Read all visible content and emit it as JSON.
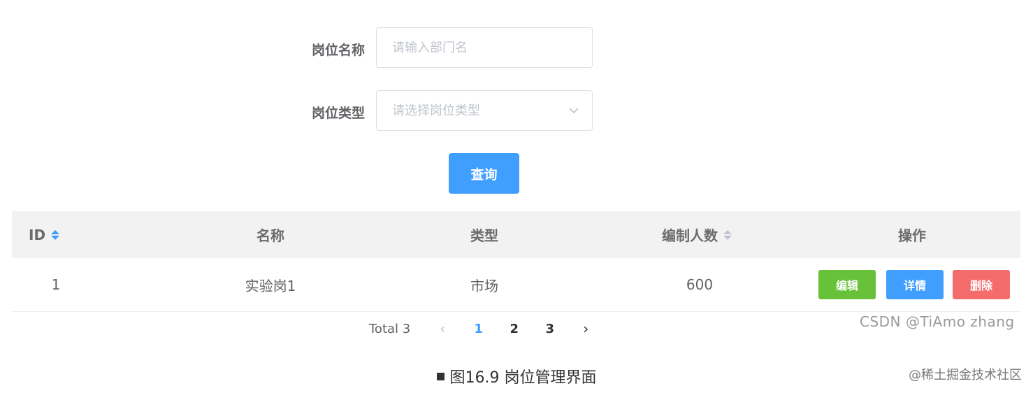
{
  "form": {
    "post_name_label": "岗位名称",
    "post_name_placeholder": "请输入部门名",
    "post_type_label": "岗位类型",
    "post_type_placeholder": "请选择岗位类型",
    "query_button": "查询"
  },
  "table": {
    "columns": [
      "ID",
      "名称",
      "类型",
      "编制人数",
      "操作"
    ],
    "rows": [
      {
        "id": "1",
        "name": "实验岗1",
        "type": "市场",
        "headcount": "600"
      }
    ],
    "actions": {
      "edit": "编辑",
      "detail": "详情",
      "delete": "删除"
    }
  },
  "pagination": {
    "total": "Total 3",
    "pages": [
      "1",
      "2",
      "3"
    ],
    "current_page": "1"
  },
  "watermark": "CSDN @TiAmo zhang",
  "caption": "图16.9 岗位管理界面",
  "corner_watermark": "@稀土掘金技术社区",
  "colors": {
    "primary": "#409eff",
    "success": "#67c23a",
    "danger": "#f56c6c"
  }
}
